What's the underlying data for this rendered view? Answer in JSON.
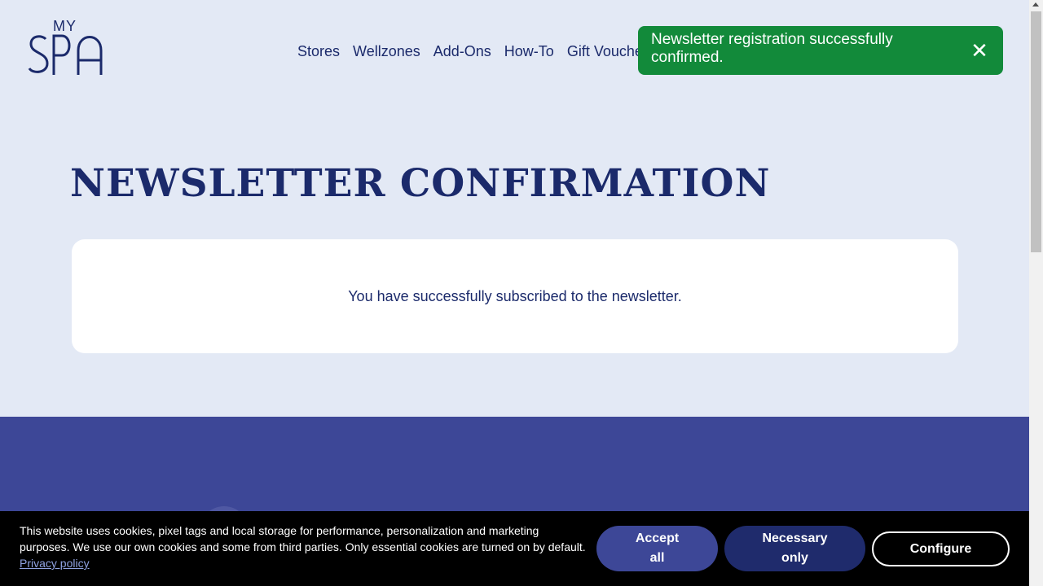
{
  "brand": {
    "logo_top": "MY",
    "logo_main": "SPA"
  },
  "nav": {
    "items": [
      "Stores",
      "Wellzones",
      "Add-Ons",
      "How-To",
      "Gift Vouche"
    ]
  },
  "toast": {
    "message": "Newsletter registration successfully confirmed.",
    "close_symbol": "✕",
    "color": "#128a3a"
  },
  "main": {
    "title": "NEWSLETTER CONFIRMATION",
    "message": "You have successfully subscribed to the newsletter."
  },
  "cookie_banner": {
    "text": "This website uses cookies, pixel tags and local storage for performance, personalization and marketing purposes. We use our own cookies and some from third parties. Only essential cookies are turned on by default.",
    "privacy_link": "Privacy policy",
    "accept_all": "Accept all",
    "necessary_only": "Necessary only",
    "configure": "Configure"
  },
  "colors": {
    "background": "#e3e9f5",
    "brand_navy": "#1b2a6b",
    "footer": "#3d4797"
  }
}
